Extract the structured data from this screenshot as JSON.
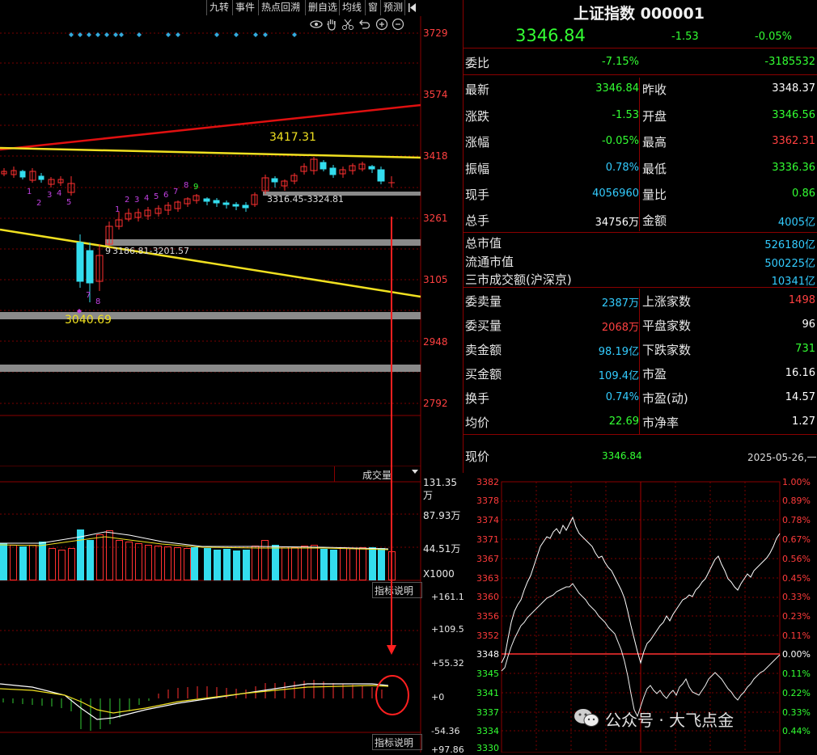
{
  "toolbar": {
    "buttons": [
      "九转",
      "事件",
      "热点回溯",
      "删自选",
      "均线",
      "窗",
      "预测"
    ],
    "tools": [
      "eye-icon",
      "hand-icon",
      "scissors-icon",
      "undo-icon",
      "zoom-in-icon",
      "zoom-out-icon"
    ]
  },
  "kline": {
    "price_axis": [
      "3729",
      "3574",
      "3418",
      "3261",
      "3105",
      "2948",
      "2792"
    ],
    "high_label": "3417.31",
    "low_label": "3040.69",
    "range_upper": "3316.45-3324.81",
    "range_lower": "3186.81-3201.57",
    "range_lower_prefix": "9",
    "seq_a": [
      "1",
      "2",
      "3",
      "4",
      "5"
    ],
    "seq_b": [
      "7",
      "8"
    ],
    "seq_c": [
      "1",
      "2",
      "3",
      "4",
      "5",
      "6",
      "7",
      "8",
      "9"
    ],
    "seq_d": [
      "1",
      "2",
      "3",
      "4",
      "5"
    ]
  },
  "volume": {
    "tab_label": "成交量",
    "axis": [
      "131.35万",
      "87.93万",
      "44.51万"
    ],
    "unit": "X1000",
    "explain": "指标说明"
  },
  "macd": {
    "axis": [
      "+161.1",
      "+109.5",
      "+55.32",
      "+0",
      "-54.36",
      "+97.86"
    ],
    "explain": "指标说明"
  },
  "quote": {
    "title": "上证指数 000001",
    "price": "3346.84",
    "change": "-1.53",
    "change_pct": "-0.05%",
    "webi_label": "委比",
    "webi_pct": "-7.15%",
    "webi_val": "-3185532",
    "rows": [
      {
        "l1": "最新",
        "v1": "3346.84",
        "c1": "#33ff33",
        "l2": "昨收",
        "v2": "3348.37",
        "c2": "#ffffff"
      },
      {
        "l1": "涨跌",
        "v1": "-1.53",
        "c1": "#33ff33",
        "l2": "开盘",
        "v2": "3346.56",
        "c2": "#33ff33"
      },
      {
        "l1": "涨幅",
        "v1": "-0.05%",
        "c1": "#33ff33",
        "l2": "最高",
        "v2": "3362.31",
        "c2": "#ff4040"
      },
      {
        "l1": "振幅",
        "v1": "0.78%",
        "c1": "#33ccff",
        "l2": "最低",
        "v2": "3336.36",
        "c2": "#33ff33"
      },
      {
        "l1": "现手",
        "v1": "4056960",
        "c1": "#33ccff",
        "l2": "量比",
        "v2": "0.86",
        "c2": "#33ff33"
      },
      {
        "l1": "总手",
        "v1": "34756万",
        "c1": "#ffffff",
        "l2": "金额",
        "v2": "4005亿",
        "c2": "#33ccff"
      }
    ],
    "mktcap": [
      {
        "l": "总市值",
        "v": "526180亿"
      },
      {
        "l": "流通市值",
        "v": "500225亿"
      },
      {
        "l": "三市成交额(沪深京)",
        "v": "10341亿"
      }
    ],
    "stats": [
      {
        "l1": "委卖量",
        "v1": "2387万",
        "c1": "#33ccff",
        "l2": "上涨家数",
        "v2": "1498",
        "c2": "#ff4040"
      },
      {
        "l1": "委买量",
        "v1": "2068万",
        "c1": "#ff4040",
        "l2": "平盘家数",
        "v2": "96",
        "c2": "#ffffff"
      },
      {
        "l1": "卖金额",
        "v1": "98.19亿",
        "c1": "#33ccff",
        "l2": "下跌家数",
        "v2": "731",
        "c2": "#33ff33"
      },
      {
        "l1": "买金额",
        "v1": "109.4亿",
        "c1": "#33ccff",
        "l2": "市盈",
        "v2": "16.16",
        "c2": "#ffffff"
      },
      {
        "l1": "换手",
        "v1": "0.74%",
        "c1": "#33ccff",
        "l2": "市盈(动)",
        "v2": "14.57",
        "c2": "#ffffff"
      },
      {
        "l1": "均价",
        "v1": "22.69",
        "c1": "#33ff33",
        "l2": "市净率",
        "v2": "1.27",
        "c2": "#ffffff"
      }
    ],
    "xianjia_label": "现价",
    "xianjia_val": "3346.84",
    "date": "2025-05-26,一"
  },
  "intraday": {
    "left_axis": [
      "3382",
      "3378",
      "3374",
      "3371",
      "3367",
      "3363",
      "3360",
      "3356",
      "3352",
      "3348",
      "3345",
      "3341",
      "3337",
      "3334",
      "3330"
    ],
    "right_axis": [
      "1.00%",
      "0.89%",
      "0.78%",
      "0.67%",
      "0.56%",
      "0.45%",
      "0.33%",
      "0.23%",
      "0.11%",
      "0.00%",
      "0.11%",
      "0.22%",
      "0.33%",
      "0.44%"
    ]
  },
  "watermark": "公众号 · 大飞点金"
}
